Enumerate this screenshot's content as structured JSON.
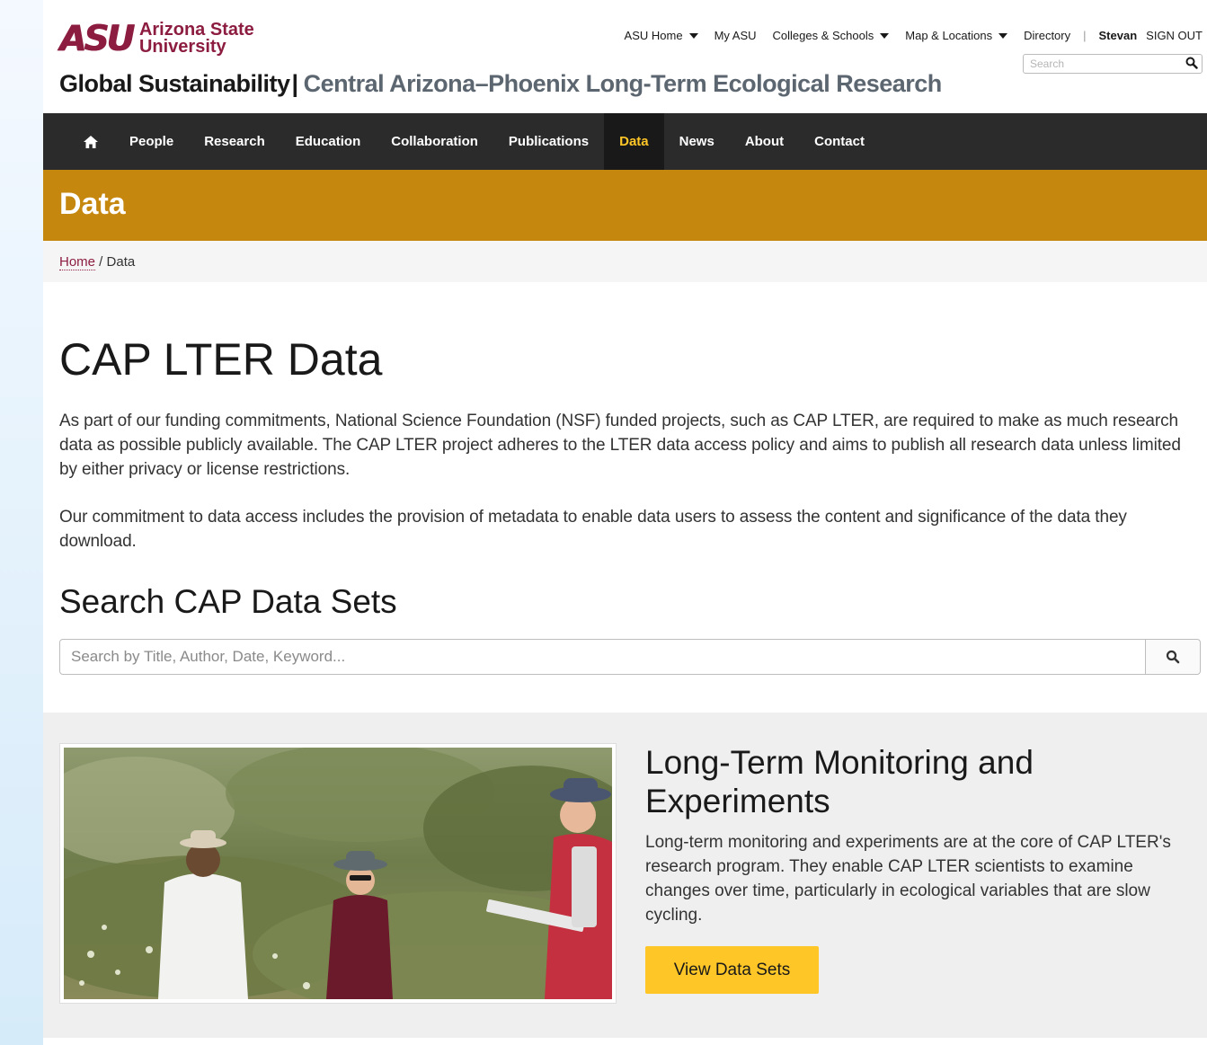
{
  "brand": {
    "mark": "ASU",
    "name_line1": "Arizona State",
    "name_line2": "University",
    "unit_parent": "Global Sustainability",
    "unit_separator": "|",
    "unit_sub": "Central Arizona–Phoenix Long-Term Ecological Research",
    "color": "#8c1d40"
  },
  "topbar": {
    "links": [
      {
        "label": "ASU Home",
        "dropdown": true
      },
      {
        "label": "My ASU",
        "dropdown": false
      },
      {
        "label": "Colleges & Schools",
        "dropdown": true
      },
      {
        "label": "Map & Locations",
        "dropdown": true
      },
      {
        "label": "Directory",
        "dropdown": false
      }
    ],
    "separator": "|",
    "user": "Stevan",
    "signout": "SIGN OUT",
    "search_placeholder": "Search"
  },
  "nav": {
    "home_icon": "home-icon",
    "items": [
      {
        "label": "People"
      },
      {
        "label": "Research"
      },
      {
        "label": "Education"
      },
      {
        "label": "Collaboration"
      },
      {
        "label": "Publications"
      },
      {
        "label": "Data",
        "active": true
      },
      {
        "label": "News"
      },
      {
        "label": "About"
      },
      {
        "label": "Contact"
      }
    ],
    "active_color": "#ffc627"
  },
  "banner": {
    "title": "Data",
    "color": "#c6870e"
  },
  "breadcrumb": {
    "home": "Home",
    "separator": " / ",
    "current": "Data"
  },
  "main": {
    "title": "CAP LTER Data",
    "paragraph1": "As part of our funding commitments, National Science Foundation (NSF) funded projects, such as CAP LTER, are required to make as much research data as possible publicly available. The CAP LTER project adheres to the LTER data access policy and aims to publish all research data unless limited by either privacy or license restrictions.",
    "paragraph2": "Our commitment to data access includes the provision of metadata to enable data users to assess the content and significance of the data they download.",
    "search_heading": "Search CAP Data Sets",
    "search_placeholder": "Search by Title, Author, Date, Keyword..."
  },
  "feature": {
    "title": "Long-Term Monitoring and Experiments",
    "text": "Long-term monitoring and experiments are at the core of CAP LTER's research program. They enable CAP LTER scientists to examine changes over time, particularly in ecological variables that are slow cycling.",
    "button_label": "View Data Sets",
    "button_color": "#ffc627"
  }
}
